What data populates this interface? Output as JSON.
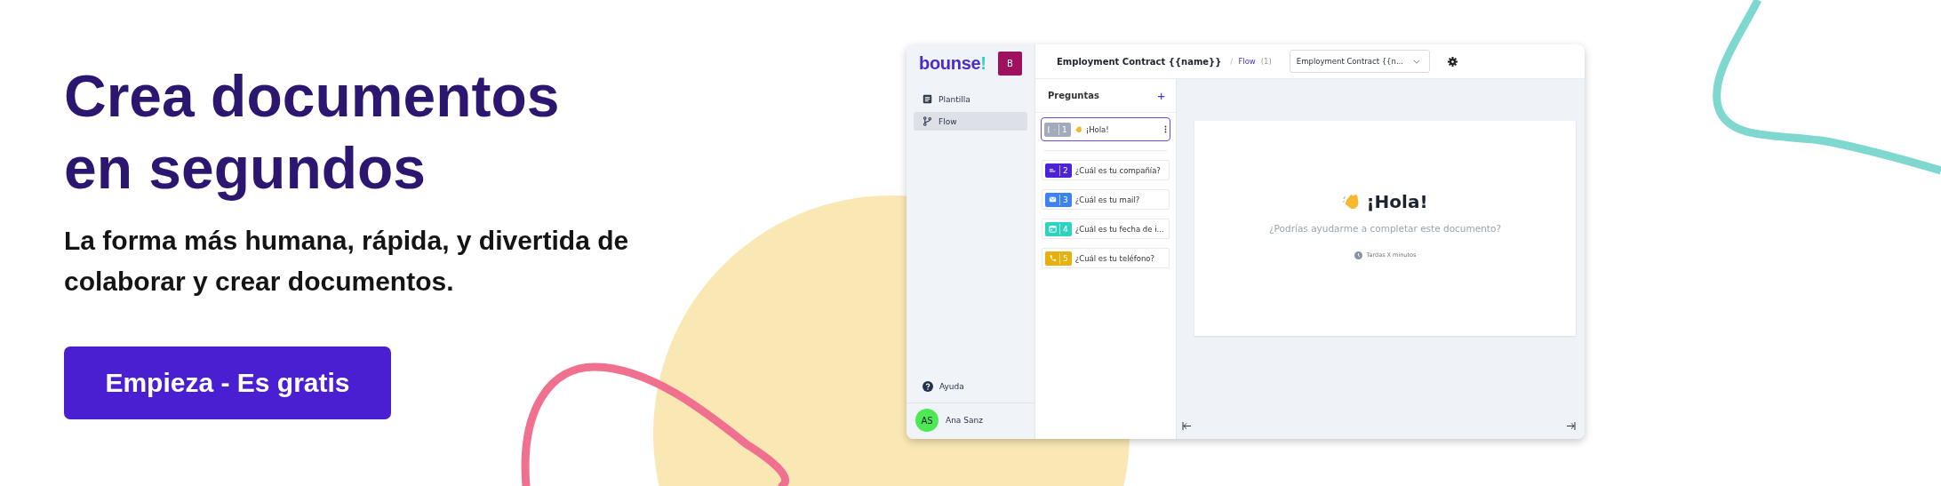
{
  "hero": {
    "headline": "Crea documentos en segundos",
    "subtitle": "La forma más humana, rápida, y divertida de colaborar y crear documentos.",
    "cta": "Empieza - Es gratis"
  },
  "app": {
    "logo": "bounse!",
    "workspace_initial": "B",
    "nav": [
      {
        "kind": "document",
        "label": "Plantilla",
        "selected": false
      },
      {
        "kind": "branch",
        "label": "Flow",
        "selected": true
      }
    ],
    "help": "Ayuda",
    "user": {
      "initials": "AS",
      "name": "Ana Sanz"
    },
    "topbar": {
      "title": "Employment Contract {{name}}",
      "separator": "/",
      "section": "Flow",
      "count": "(1)",
      "dropdown": "Employment Contract {{n..."
    },
    "questions_panel": {
      "title": "Preguntas",
      "add": "+",
      "questions": [
        {
          "kind": "welcome",
          "number": "1",
          "text": "¡Hola!",
          "selected": true,
          "color": "#a3abba"
        },
        {
          "kind": "text",
          "number": "2",
          "text": "¿Cuál es tu compañía?",
          "selected": false,
          "color": "#4b22d8"
        },
        {
          "kind": "email",
          "number": "3",
          "text": "¿Cuál es tu mail?",
          "selected": false,
          "color": "#3b82f6"
        },
        {
          "kind": "date",
          "number": "4",
          "text": "¿Cuál es tu fecha de i...",
          "selected": false,
          "color": "#2ed3c0"
        },
        {
          "kind": "phone",
          "number": "5",
          "text": "¿Cuál es tu teléfono?",
          "selected": false,
          "color": "#e8b00c"
        }
      ]
    },
    "preview": {
      "heading": "¡Hola!",
      "subtitle": "¿Podrías ayudarme a completar este documento?",
      "duration": "Tardas X minutos"
    }
  }
}
